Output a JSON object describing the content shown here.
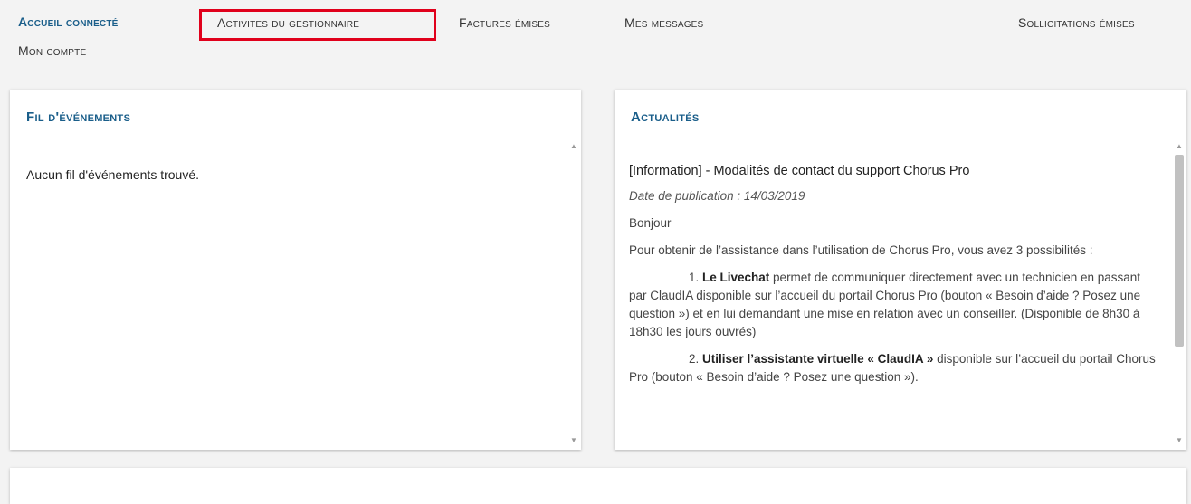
{
  "nav": {
    "items": [
      {
        "label": "Accueil connecté",
        "active": true
      },
      {
        "label": "Activites du gestionnaire",
        "active": false
      },
      {
        "label": "Factures émises",
        "active": false
      },
      {
        "label": "Mes messages",
        "active": false
      },
      {
        "label": "Sollicitations émises",
        "active": false
      },
      {
        "label": "Mon compte",
        "active": false
      }
    ]
  },
  "events_panel": {
    "title": "Fil d'événements",
    "empty_text": "Aucun fil d'événements trouvé."
  },
  "news_panel": {
    "title": "Actualités",
    "article": {
      "title": "[Information] - Modalités de contact du support Chorus Pro",
      "date_label": "Date de publication : 14/03/2019",
      "greeting": "Bonjour",
      "intro": "Pour obtenir de l’assistance dans l’utilisation de Chorus Pro, vous avez 3 possibilités :",
      "item1_num": "1. ",
      "item1_bold": "Le Livechat",
      "item1_text": " permet de communiquer directement avec un technicien en passant par ClaudIA disponible sur l’accueil du portail Chorus Pro  (bouton « Besoin d’aide ? Posez une question ») et en lui demandant une mise en relation avec un conseiller. (Disponible de 8h30 à 18h30 les jours ouvrés)",
      "item2_num": "2. ",
      "item2_bold": "Utiliser l’assistante virtuelle « ClaudIA »",
      "item2_text": " disponible sur l’accueil du portail Chorus Pro  (bouton « Besoin d’aide ? Posez une question »)."
    }
  },
  "colors": {
    "accent": "#1a5e8a",
    "highlight": "#e0001b",
    "background": "#f3f3f3"
  },
  "icons": [
    "scroll-up-arrow-icon",
    "scroll-down-arrow-icon"
  ]
}
